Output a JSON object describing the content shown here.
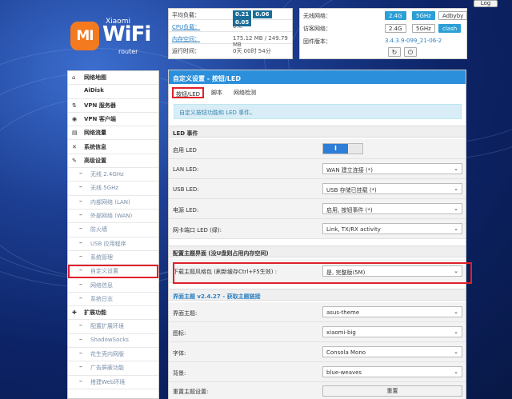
{
  "logout": "Log",
  "logo": {
    "badge": "MI",
    "xiaomi": "Xiaomi",
    "wifi": "WiFi",
    "router": "router"
  },
  "status": {
    "load_label": "平均负载：",
    "loads": [
      "0.21",
      "0.06",
      "0.05"
    ],
    "cpu_label": "CPU负载：",
    "cpu_value": "0%",
    "mem_label": "内存空间：",
    "mem_value": "175.12 MB / 249.79 MB",
    "uptime_label": "运行时间：",
    "uptime_value": "0天 00时 54分"
  },
  "network": {
    "wireless_label": "无线网络：",
    "wireless_24": "2.4G",
    "wireless_5": "5GHz",
    "wireless_ssid": "Adbyby",
    "guest_label": "访客网络：",
    "guest_24": "2.4G",
    "guest_5": "5GHz",
    "guest_clash": "clash",
    "firmware_label": "固件版本：",
    "firmware_value": "3.4.3.9-099_21-06-2"
  },
  "sidebar": {
    "items": [
      {
        "icon": "home-icon",
        "glyph": "⌂",
        "label": "网络地图",
        "type": "main"
      },
      {
        "icon": "",
        "glyph": "",
        "label": "AiDisk",
        "type": "main"
      },
      {
        "icon": "vpn-server-icon",
        "glyph": "⇅",
        "label": "VPN 服务器",
        "type": "main"
      },
      {
        "icon": "globe-icon",
        "glyph": "◉",
        "label": "VPN 客户端",
        "type": "main"
      },
      {
        "icon": "table-icon",
        "glyph": "▤",
        "label": "网络流量",
        "type": "main"
      },
      {
        "icon": "shuffle-icon",
        "glyph": "✕",
        "label": "系统信息",
        "type": "main"
      },
      {
        "icon": "wrench-icon",
        "glyph": "✎",
        "label": "高级设置",
        "type": "main"
      },
      {
        "label": "无线 2.4GHz",
        "type": "sub"
      },
      {
        "label": "无线 5GHz",
        "type": "sub"
      },
      {
        "label": "内部网络 (LAN)",
        "type": "sub"
      },
      {
        "label": "外部网络 (WAN)",
        "type": "sub"
      },
      {
        "label": "防火墙",
        "type": "sub"
      },
      {
        "label": "USB 应用程序",
        "type": "sub"
      },
      {
        "label": "系统管理",
        "type": "sub"
      },
      {
        "label": "自定义设置",
        "type": "sub",
        "active": true
      },
      {
        "label": "网络信息",
        "type": "sub"
      },
      {
        "label": "系统日志",
        "type": "sub"
      },
      {
        "icon": "puzzle-icon",
        "glyph": "✚",
        "label": "扩展功能",
        "type": "main"
      },
      {
        "label": "配置扩展环境",
        "type": "sub"
      },
      {
        "label": "ShadowSocks",
        "type": "sub"
      },
      {
        "label": "花生壳内网版",
        "type": "sub"
      },
      {
        "label": "广告屏蔽功能",
        "type": "sub"
      },
      {
        "label": "搭建Web环境",
        "type": "sub"
      }
    ]
  },
  "content": {
    "title": "自定义设置 - 按钮/LED",
    "tabs": [
      "按钮/LED",
      "脚本",
      "网络检测"
    ],
    "info": "自定义按钮功能和 LED 事件。",
    "led_section": "LED 事件",
    "rows1": [
      {
        "label": "启用 LED",
        "kind": "toggle",
        "value": "I"
      },
      {
        "label": "LAN LED:",
        "kind": "select",
        "value": "WAN 建立连接 (*)"
      },
      {
        "label": "USB LED:",
        "kind": "select",
        "value": "USB 存储已挂载 (*)"
      },
      {
        "label": "电源 LED:",
        "kind": "select",
        "value": "启用, 按钮事件 (*)"
      },
      {
        "label": "网卡端口 LED (绿):",
        "kind": "select",
        "value": "Link, TX/RX activity"
      }
    ],
    "theme_section": "配置主题界面 (没U盘则占用内存空间)",
    "theme_row": {
      "label": "下载主题风格包 (刷新缓存Ctrl+F5生效) :",
      "value": "是, 完整版(5M)"
    },
    "ui_section": "界面主题 v2.4.27 - 获取主题链接",
    "rows2": [
      {
        "label": "界面主题:",
        "value": "asus-theme"
      },
      {
        "label": "图标:",
        "value": "xiaomi-big"
      },
      {
        "label": "字体:",
        "value": "Consola Mono"
      },
      {
        "label": "背景:",
        "value": "blue-weaves"
      }
    ],
    "reset_label": "重置主题设置:",
    "reset_button": "重置"
  }
}
